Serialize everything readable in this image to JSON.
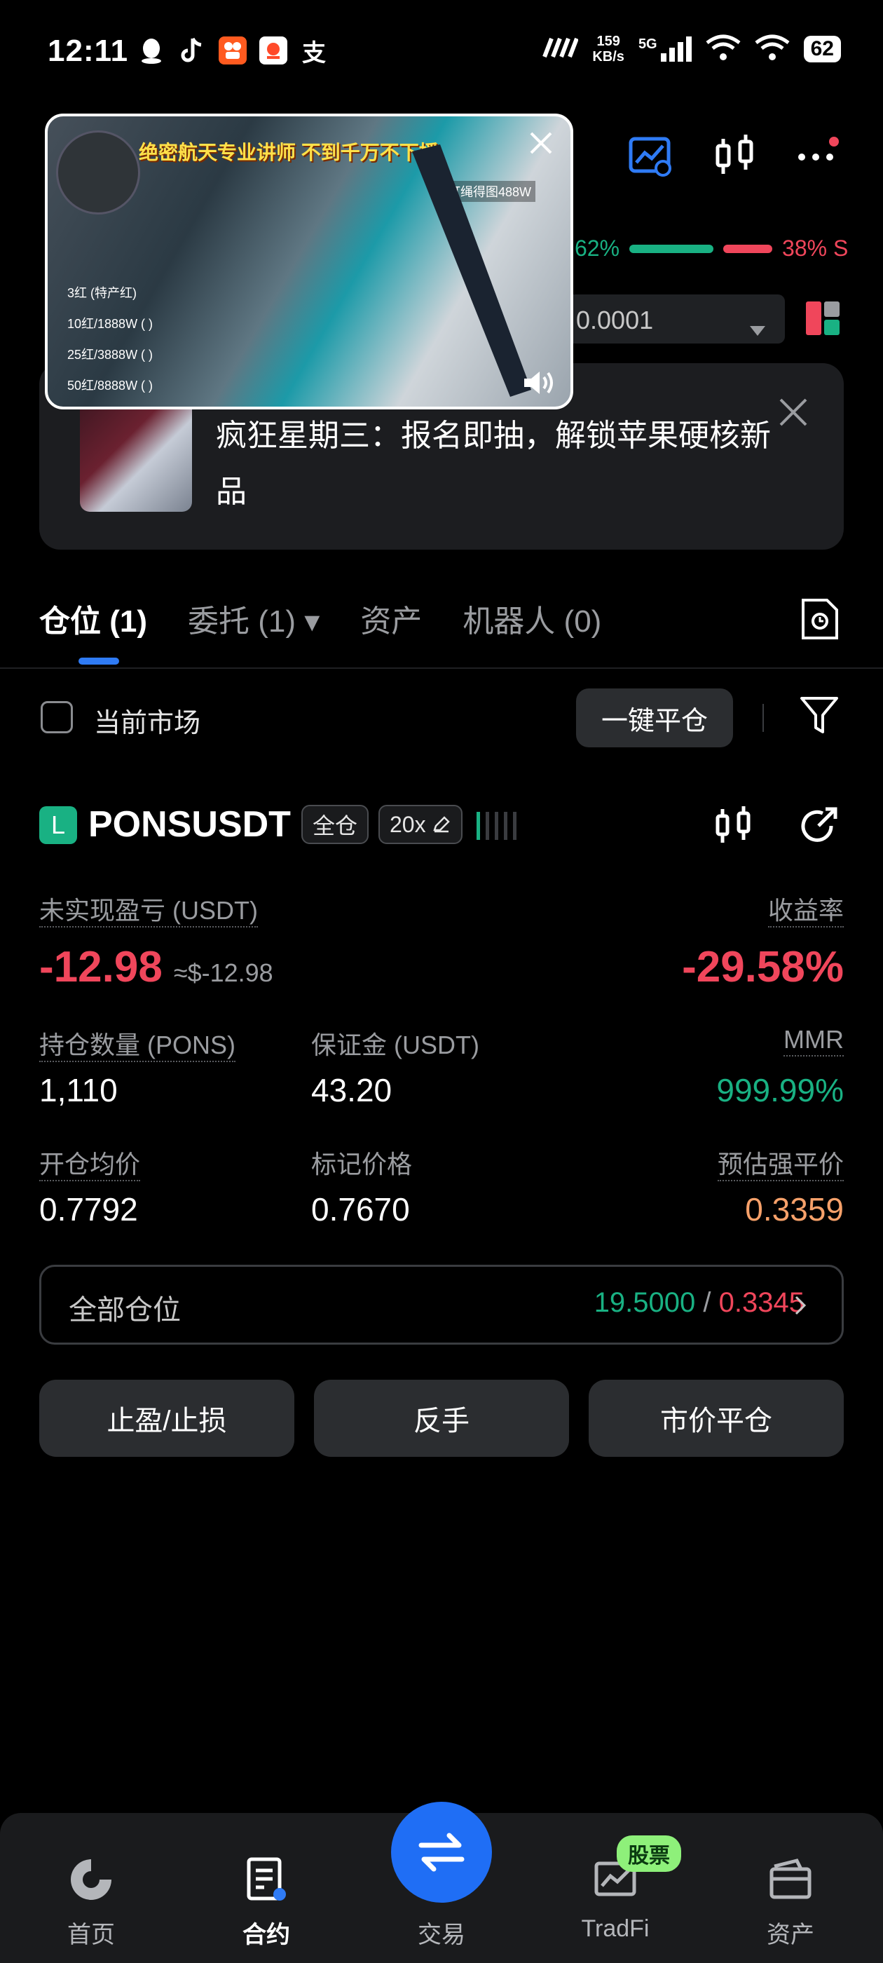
{
  "status_bar": {
    "time": "12:11",
    "net_speed_value": "159",
    "net_speed_unit": "KB/s",
    "network": "5G",
    "battery": "62",
    "app_icons": [
      "qq-icon",
      "tiktok-icon",
      "kuaishou-icon",
      "quanmin-icon",
      "alipay-icon"
    ]
  },
  "header": {
    "long_ratio": "62%",
    "short_ratio": "38% S",
    "qty_value": "0.0001"
  },
  "video_overlay": {
    "title": "绝密航天专业讲师  不到千万不下播",
    "badge": "灯绳得图488W",
    "gifts": [
      "3红 (特产红)",
      "10红/1888W (   )",
      "25红/3888W (   )",
      "50红/8888W (   )"
    ]
  },
  "banner": {
    "text": "疯狂星期三：报名即抽，解锁苹果硬核新品"
  },
  "tabs": [
    {
      "label": "仓位 (1)",
      "active": true
    },
    {
      "label": "委托 (1) ▾",
      "active": false
    },
    {
      "label": "资产",
      "active": false
    },
    {
      "label": "机器人 (0)",
      "active": false
    }
  ],
  "filters": {
    "current_market": "当前市场",
    "close_all": "一键平仓"
  },
  "position": {
    "side_badge": "L",
    "symbol": "PONSUSDT",
    "margin_mode": "全仓",
    "leverage": "20x",
    "unrealized_pnl_label": "未实现盈亏 (USDT)",
    "unrealized_pnl": "-12.98",
    "unrealized_pnl_usd": "≈$-12.98",
    "roe_label": "收益率",
    "roe": "-29.58%",
    "size_label": "持仓数量 (PONS)",
    "size": "1,110",
    "margin_label": "保证金 (USDT)",
    "margin": "43.20",
    "mmr_label": "MMR",
    "mmr": "999.99%",
    "entry_label": "开仓均价",
    "entry": "0.7792",
    "mark_label": "标记价格",
    "mark": "0.7670",
    "liq_label": "预估强平价",
    "liq": "0.3359",
    "all_positions_label": "全部仓位",
    "tp_value": "19.5000",
    "sl_value": "0.3345",
    "slash": "/",
    "btn_tpsl": "止盈/止损",
    "btn_reverse": "反手",
    "btn_market_close": "市价平仓"
  },
  "bottom_nav": {
    "home": "首页",
    "contract": "合约",
    "trade": "交易",
    "tradfi": "TradFi",
    "stock_badge": "股票",
    "assets": "资产"
  },
  "colors": {
    "green": "#19b183",
    "red": "#f0465b",
    "orange": "#f7a16a",
    "blue": "#2f7bf5"
  }
}
